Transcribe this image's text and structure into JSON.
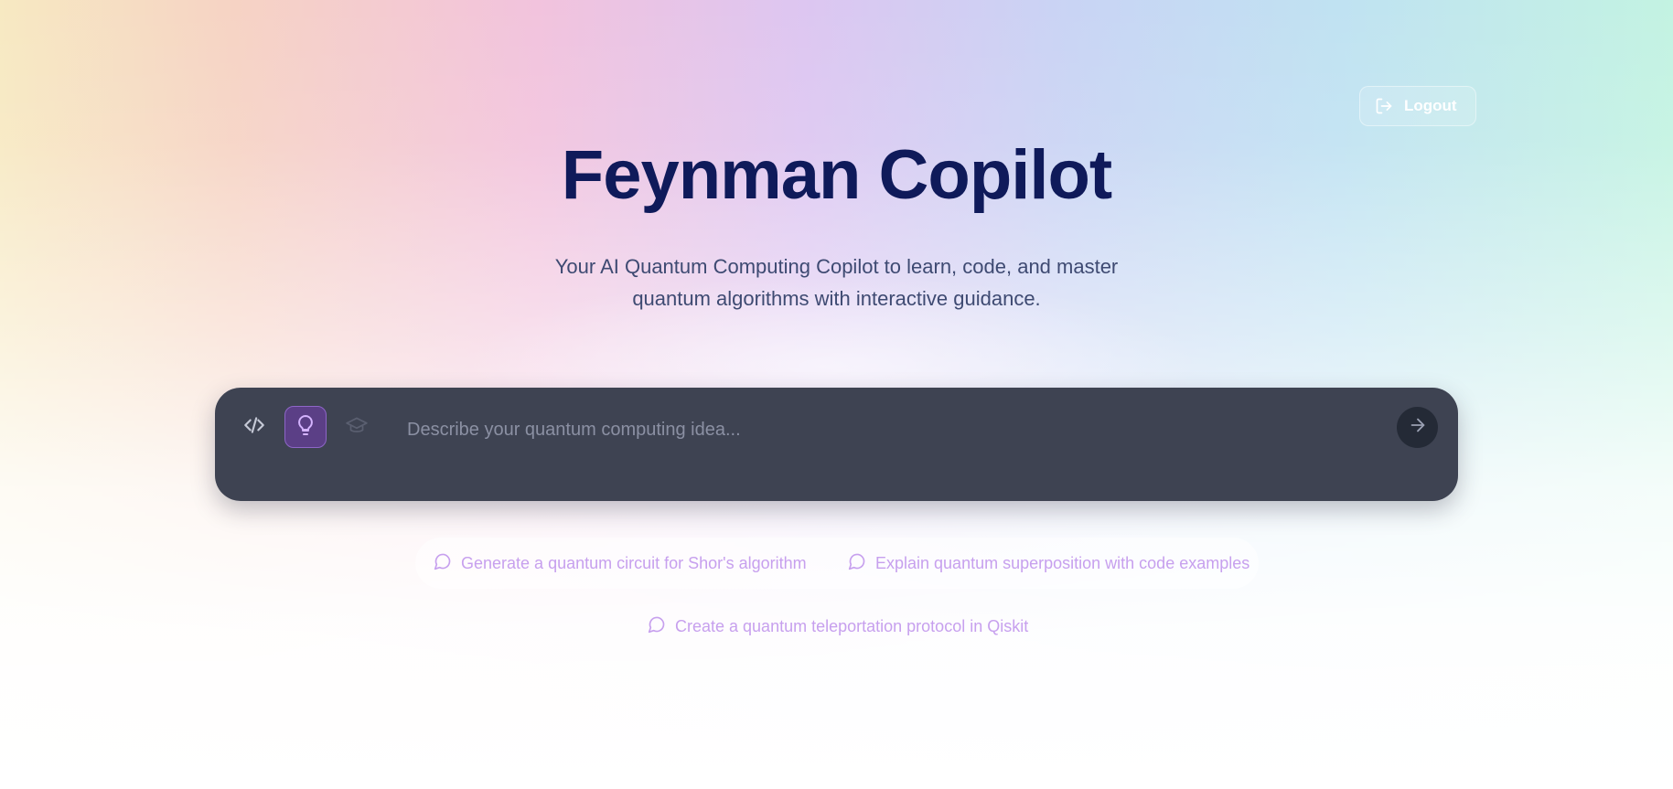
{
  "header": {
    "logout_label": "Logout"
  },
  "hero": {
    "title": "Feynman Copilot",
    "subtitle": "Your AI Quantum Computing Copilot to learn, code, and master quantum algorithms with interactive guidance."
  },
  "composer": {
    "placeholder": "Describe your quantum computing idea...",
    "value": "",
    "modes": [
      {
        "name": "code",
        "icon": "code-brackets-icon",
        "active": false
      },
      {
        "name": "idea",
        "icon": "lightbulb-icon",
        "active": true
      },
      {
        "name": "learn",
        "icon": "graduation-cap-icon",
        "active": false
      }
    ],
    "send_icon": "arrow-right-icon"
  },
  "suggestions": [
    "Generate a quantum circuit for Shor's algorithm",
    "Explain quantum superposition with code examples",
    "Create a quantum teleportation protocol in Qiskit"
  ],
  "colors": {
    "title": "#0f1a5a",
    "subtitle": "#3e4a72",
    "composer_bg": "#3e4352",
    "active_mode_bg": "#5b3f86",
    "active_mode_icon": "#d5b4ff",
    "send_button_bg": "#242a36",
    "suggestion_text": "#c7a0ee"
  }
}
